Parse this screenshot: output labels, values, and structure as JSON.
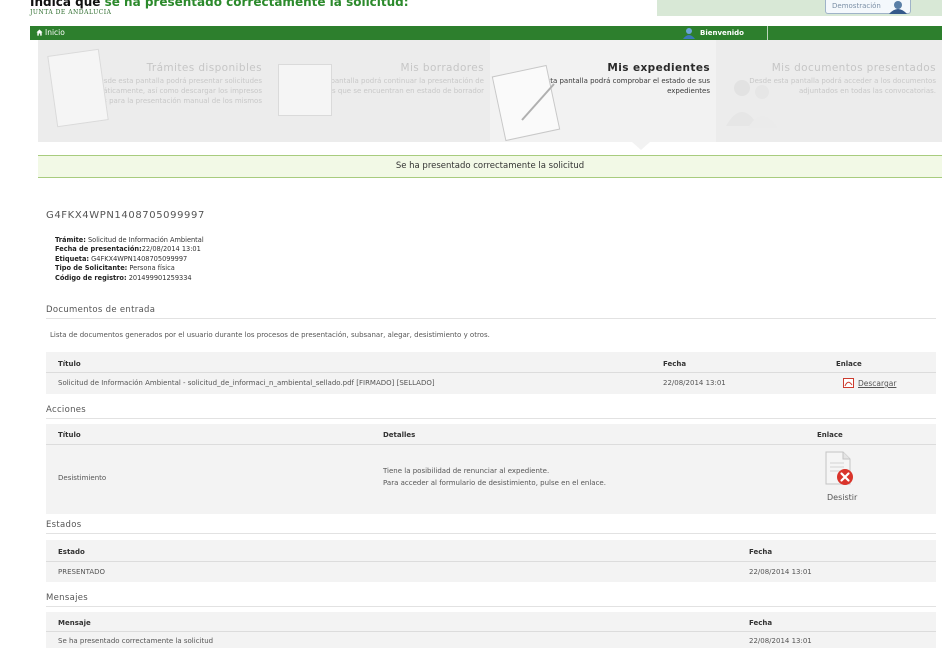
{
  "caption": {
    "prefix": "Indica que ",
    "highlight": "se ha presentado correctamente la solicitud:"
  },
  "header": {
    "org": "JUNTA DE ANDALUCIA",
    "demo_label": "Demostración"
  },
  "navbar": {
    "home_label": "Inicio",
    "welcome_label": "Bienvenido"
  },
  "tiles": [
    {
      "title": "Trámites disponibles",
      "desc": [
        "Desde esta pantalla podrá presentar solicitudes",
        "telemáticamente, así como descargar los impresos",
        "necesarios para la presentación manual de los mismos"
      ]
    },
    {
      "title": "Mis borradores",
      "desc": [
        "Desde esta pantalla podrá continuar la presentación de",
        "sus solicitudes que se encuentran en estado de borrador"
      ]
    },
    {
      "title": "Mis expedientes",
      "desc": [
        "Desde esta pantalla podrá comprobar el estado de sus",
        "expedientes"
      ]
    },
    {
      "title": "Mis documentos presentados",
      "desc": [
        "Desde esta pantalla podrá acceder a los documentos",
        "adjuntados en todas las convocatorias."
      ]
    }
  ],
  "banner": "Se ha presentado correctamente la solicitud",
  "expediente": {
    "id": "G4FKX4WPN1408705099997",
    "tramite_label": "Trámite:",
    "tramite_value": " Solicitud de Información Ambiental",
    "fecha_label": "Fecha de presentación:",
    "fecha_value": "22/08/2014 13:01",
    "etiqueta_label": "Etiqueta:",
    "etiqueta_value": " G4FKX4WPN1408705099997",
    "tipo_label": "Tipo de Solicitante:",
    "tipo_value": " Persona física",
    "codigo_label": "Código de registro:",
    "codigo_value": " 201499901259334"
  },
  "documentos": {
    "title": "Documentos de entrada",
    "lista": "Lista de documentos generados por el usuario durante los procesos de presentación, subsanar, alegar, desistimiento y otros.",
    "headers": {
      "titulo": "Título",
      "fecha": "Fecha",
      "enlace": "Enlace"
    },
    "rows": [
      {
        "titulo": "Solicitud de Información Ambiental - solicitud_de_informaci_n_ambiental_sellado.pdf [FIRMADO] [SELLADO]",
        "fecha": "22/08/2014 13:01",
        "enlace": "Descargar"
      }
    ]
  },
  "acciones": {
    "title": "Acciones",
    "headers": {
      "titulo": "Título",
      "detalles": "Detalles",
      "enlace": "Enlace"
    },
    "rows": [
      {
        "titulo": "Desistimiento",
        "detalle1": "Tiene la posibilidad de renunciar al expediente.",
        "detalle2": "Para acceder al formulario de desistimiento, pulse en el enlace.",
        "enlace": "Desistir"
      }
    ]
  },
  "estados": {
    "title": "Estados",
    "headers": {
      "estado": "Estado",
      "fecha": "Fecha"
    },
    "rows": [
      {
        "estado": "PRESENTADO",
        "fecha": "22/08/2014 13:01"
      }
    ]
  },
  "mensajes": {
    "title": "Mensajes",
    "headers": {
      "mensaje": "Mensaje",
      "fecha": "Fecha"
    },
    "rows": [
      {
        "mensaje": "Se ha presentado correctamente la solicitud",
        "fecha": "22/08/2014 13:01"
      }
    ]
  },
  "colors": {
    "brand_green": "#2d7f2d",
    "success_border": "#a8cc7e",
    "success_bg": "#f2f9e6",
    "error_red": "#d9342b"
  }
}
